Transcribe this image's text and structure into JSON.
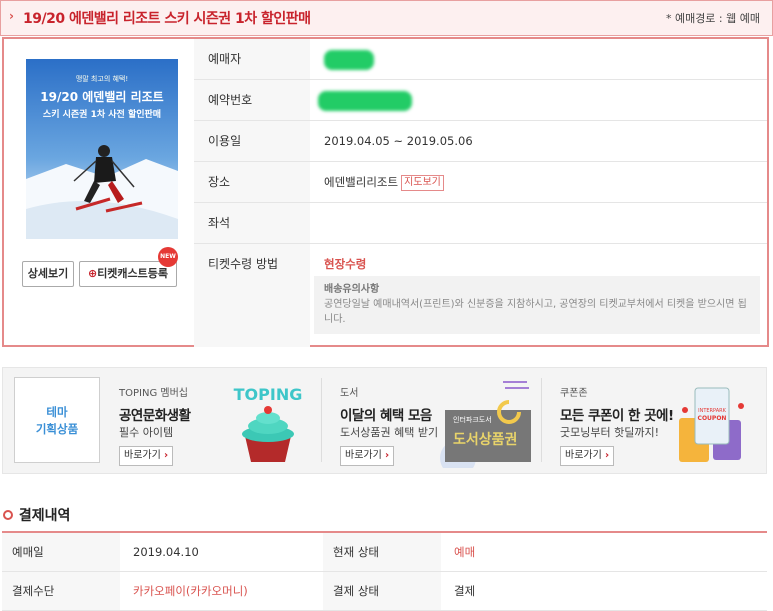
{
  "header": {
    "title": "19/20 에덴밸리 리조트 스키 시즌권 1차 할인판매",
    "route": "* 예매경로 : 웹 예매"
  },
  "poster": {
    "line1": "맹말 최고의 혜택!",
    "line2": "19/20 에덴밸리 리조트",
    "line3": "스키 시즌권 1차 사전 할인판매"
  },
  "buttons": {
    "detail": "상세보기",
    "ticketcast": "티켓캐스트등록",
    "new_badge": "NEW"
  },
  "booking": {
    "booker_label": "예매자",
    "reservation_label": "예약번호",
    "date_label": "이용일",
    "date_value": "2019.04.05 ~ 2019.05.06",
    "place_label": "장소",
    "place_value": "에덴밸리리조트",
    "map_button": "지도보기",
    "seat_label": "좌석",
    "seat_value": "",
    "receive_label": "티켓수령 방법",
    "receive_value": "현장수령",
    "notice_title": "배송유의사항",
    "notice_text": "공연당일날 예매내역서(프린트)와 신분증을 지참하시고, 공연장의 티켓교부처에서 티켓을 받으시면 됩니다."
  },
  "promo": {
    "theme_line1": "테마",
    "theme_line2": "기획상품",
    "cards": [
      {
        "category": "TOPING 멤버십",
        "title": "공연문화생활",
        "subtitle": "필수 아이템",
        "button": "바로가기",
        "art_text": "TOPING"
      },
      {
        "category": "도서",
        "title": "이달의 혜택 모음",
        "subtitle": "도서상품권 혜택 받기",
        "button": "바로가기",
        "art_small": "인터파크도서",
        "art_text": "도서상품권"
      },
      {
        "category": "쿠폰존",
        "title": "모든 쿠폰이 한 곳에!",
        "subtitle": "굿모닝부터 핫딜까지!",
        "button": "바로가기",
        "art_small": "INTERPARK",
        "art_text": "COUPON"
      }
    ]
  },
  "payment": {
    "section_title": "결제내역",
    "rows": [
      {
        "label1": "예매일",
        "value1": "2019.04.10",
        "label2": "현재 상태",
        "value2": "예매"
      },
      {
        "label1": "결제수단",
        "value1": "카카오페이(카카오머니)",
        "label2": "결제 상태",
        "value2": "결제"
      }
    ]
  },
  "colors": {
    "accent": "#c8232c",
    "border": "#e58a8a",
    "link_blue": "#3a8fd6",
    "mask_green": "#22cc66"
  }
}
